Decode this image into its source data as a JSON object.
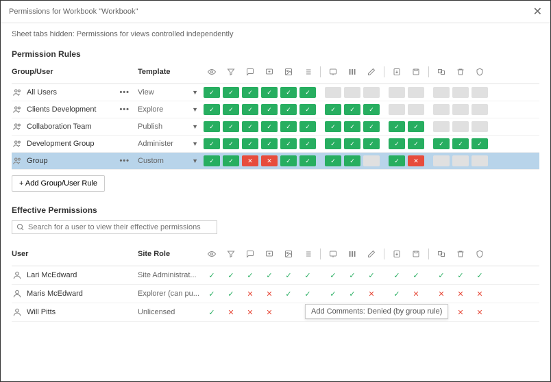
{
  "header": {
    "title": "Permissions for Workbook \"Workbook\""
  },
  "subtitle": "Sheet tabs hidden: Permissions for views controlled independently",
  "rules": {
    "title": "Permission Rules",
    "col_group": "Group/User",
    "col_template": "Template",
    "add_label": "+ Add Group/User Rule",
    "rows": [
      {
        "name": "All Users",
        "template": "View",
        "perms": [
          "a",
          "a",
          "a",
          "a",
          "a",
          "a",
          "n",
          "n",
          "n",
          "n",
          "n",
          "n",
          "n",
          "n"
        ],
        "menu": true
      },
      {
        "name": "Clients Development",
        "template": "Explore",
        "perms": [
          "a",
          "a",
          "a",
          "a",
          "a",
          "a",
          "a",
          "a",
          "a",
          "n",
          "n",
          "n",
          "n",
          "n"
        ],
        "menu": true
      },
      {
        "name": "Collaboration Team",
        "template": "Publish",
        "perms": [
          "a",
          "a",
          "a",
          "a",
          "a",
          "a",
          "a",
          "a",
          "a",
          "a",
          "a",
          "n",
          "n",
          "n"
        ],
        "menu": false
      },
      {
        "name": "Development Group",
        "template": "Administer",
        "perms": [
          "a",
          "a",
          "a",
          "a",
          "a",
          "a",
          "a",
          "a",
          "a",
          "a",
          "a",
          "a",
          "a",
          "a"
        ],
        "menu": false
      },
      {
        "name": "Group",
        "template": "Custom",
        "perms": [
          "a",
          "a",
          "d",
          "d",
          "a",
          "a",
          "a",
          "a",
          "n",
          "a",
          "d",
          "n",
          "n",
          "n"
        ],
        "menu": true,
        "selected": true
      }
    ]
  },
  "effective": {
    "title": "Effective Permissions",
    "search_placeholder": "Search for a user to view their effective permissions",
    "col_user": "User",
    "col_role": "Site Role",
    "tooltip": "Add Comments: Denied (by group rule)",
    "rows": [
      {
        "name": "Lari McEdward",
        "role": "Site Administrat...",
        "perms": [
          "a",
          "a",
          "a",
          "a",
          "a",
          "a",
          "a",
          "a",
          "a",
          "a",
          "a",
          "a",
          "a",
          "a"
        ]
      },
      {
        "name": "Maris McEdward",
        "role": "Explorer (can pu...",
        "perms": [
          "a",
          "a",
          "d",
          "d",
          "a",
          "a",
          "a",
          "a",
          "d",
          "a",
          "d",
          "d",
          "d",
          "d"
        ]
      },
      {
        "name": "Will Pitts",
        "role": "Unlicensed",
        "perms": [
          "a",
          "d",
          "d",
          "d",
          "",
          "",
          "",
          "",
          "",
          "a",
          "d",
          "d",
          "d",
          "d"
        ]
      }
    ]
  },
  "perm_columns": [
    {
      "name": "view",
      "group": 0
    },
    {
      "name": "filter",
      "group": 0
    },
    {
      "name": "comments",
      "group": 0
    },
    {
      "name": "add-comments",
      "group": 0
    },
    {
      "name": "image",
      "group": 0
    },
    {
      "name": "summary",
      "group": 0
    },
    {
      "name": "share",
      "group": 1
    },
    {
      "name": "web-edit",
      "group": 1
    },
    {
      "name": "edit",
      "group": 1
    },
    {
      "name": "download",
      "group": 2
    },
    {
      "name": "save",
      "group": 2
    },
    {
      "name": "move",
      "group": 3
    },
    {
      "name": "delete",
      "group": 3
    },
    {
      "name": "set-perms",
      "group": 3
    }
  ]
}
